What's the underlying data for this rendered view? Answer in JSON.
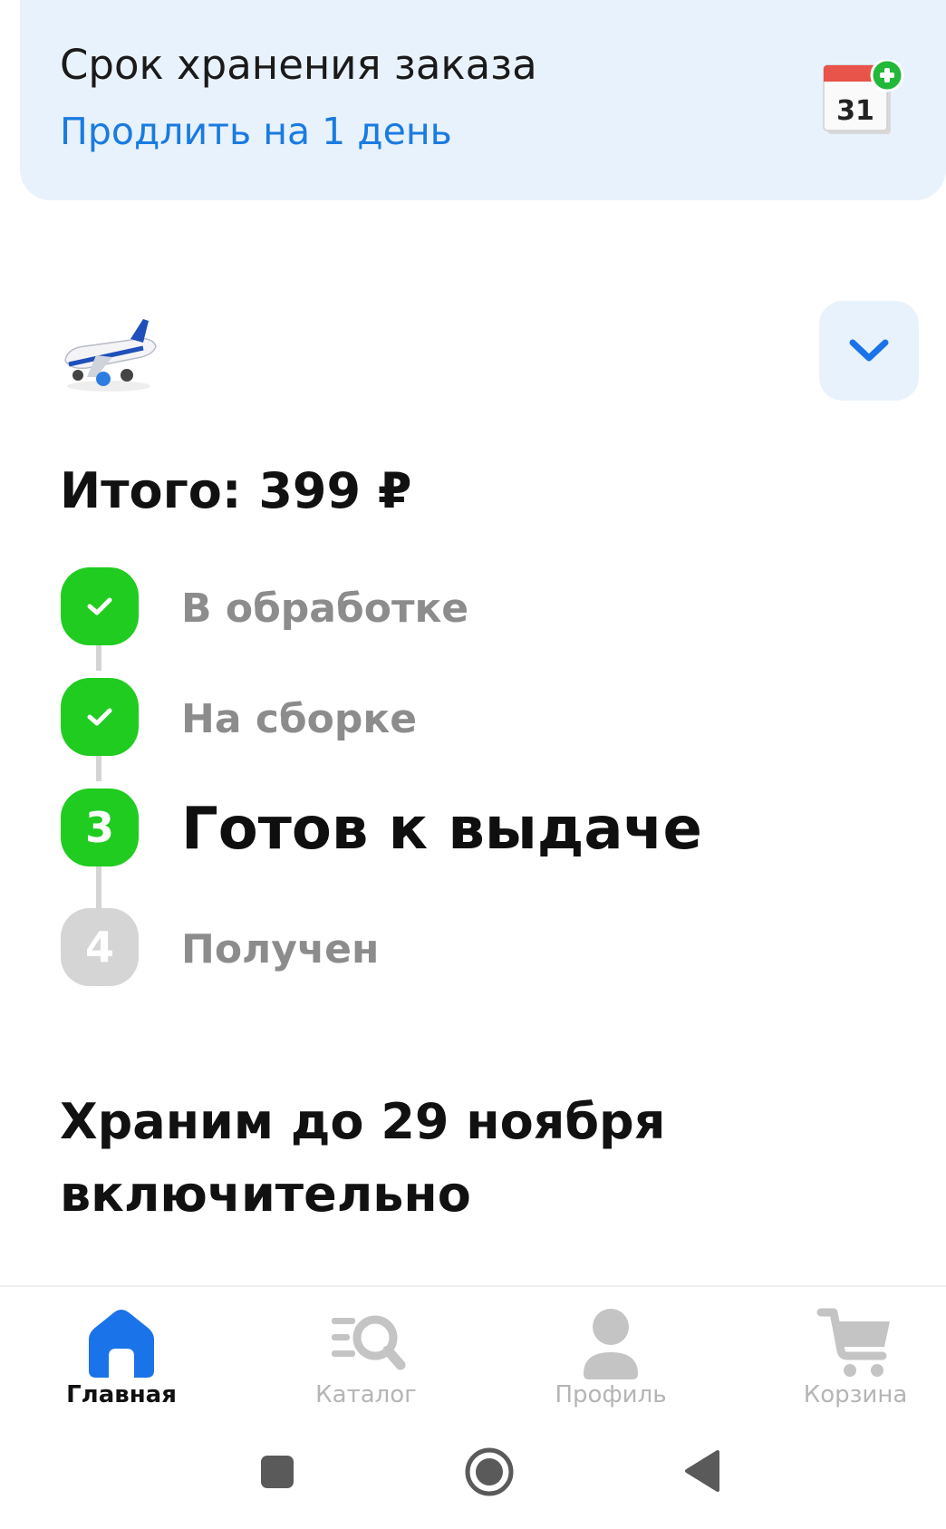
{
  "storage": {
    "title": "Срок хранения заказа",
    "extend_link": "Продлить на 1 день",
    "calendar_day": "31"
  },
  "order": {
    "total_label": "Итого:",
    "total_value": "399 ₽"
  },
  "steps": [
    {
      "label": "В обработке",
      "state": "done"
    },
    {
      "label": "На сборке",
      "state": "done"
    },
    {
      "number": "3",
      "label": "Готов к выдаче",
      "state": "current"
    },
    {
      "number": "4",
      "label": "Получен",
      "state": "pending"
    }
  ],
  "storage_until": "Храним до 29 ноября включительно",
  "nav": [
    {
      "label": "Главная",
      "icon": "home-icon",
      "active": true
    },
    {
      "label": "Каталог",
      "icon": "catalog-search-icon",
      "active": false
    },
    {
      "label": "Профиль",
      "icon": "profile-icon",
      "active": false
    },
    {
      "label": "Корзина",
      "icon": "cart-icon",
      "active": false
    }
  ],
  "colors": {
    "accent_blue": "#1a7be0",
    "nav_active_blue": "#1a73e8",
    "banner_bg": "#e8f2fc",
    "step_green": "#1fcc1f",
    "step_grey": "#d5d5d5",
    "calendar_red": "#e8534a"
  }
}
